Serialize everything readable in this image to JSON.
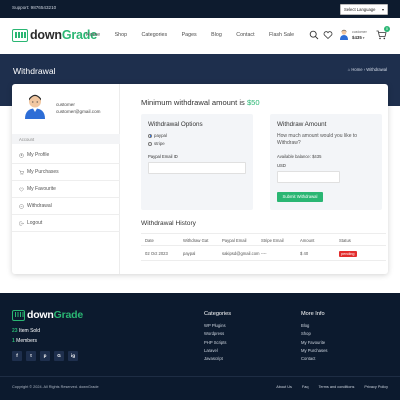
{
  "topbar": {
    "support": "Support: 9876543210",
    "language": "Select Language"
  },
  "header": {
    "logo_main": "down",
    "logo_accent": "Grade",
    "nav": [
      "Home",
      "Shop",
      "Categories",
      "Pages",
      "Blog",
      "Contact",
      "Flash Sale"
    ],
    "customer_label": "customer",
    "customer_balance": "$435",
    "cart_count": "0"
  },
  "banner": {
    "title": "Withdrawal",
    "crumb_home": "Home",
    "crumb_current": "Withdrawal"
  },
  "sidebar": {
    "username": "customer",
    "email": "customer@gmail.com",
    "account_heading": "Account",
    "items": [
      {
        "label": "My Profile",
        "icon": "user-icon"
      },
      {
        "label": "My Purchases",
        "icon": "cart-icon"
      },
      {
        "label": "My Favourite",
        "icon": "heart-icon"
      },
      {
        "label": "Withdrawal",
        "icon": "wallet-icon"
      },
      {
        "label": "Logout",
        "icon": "logout-icon"
      }
    ]
  },
  "main": {
    "min_label": "Minimum withdrawal amount is ",
    "min_amount": "$50",
    "options": {
      "heading": "Withdrawal Options",
      "radio1": "paypal",
      "radio2": "stripe",
      "selected": "paypal",
      "email_label": "Paypal Email ID"
    },
    "amount": {
      "heading": "Withdraw Amount",
      "question": "How much amount would you like to Withdraw?",
      "balance": "Available balance: $435",
      "currency": "USD",
      "button": "Submit Withdrawal"
    },
    "history": {
      "heading": "Withdrawal History",
      "columns": [
        "Date",
        "Withdraw Gat",
        "Paypal Email",
        "Stripe Email",
        "Amount",
        "Status"
      ],
      "rows": [
        {
          "date": "02 Oct 2023",
          "gateway": "paypal",
          "paypal_email": "sakipsd@gmail.com",
          "stripe_email": "----",
          "amount": "$ 40",
          "status": "pending"
        }
      ]
    }
  },
  "footer": {
    "logo_main": "down",
    "logo_accent": "Grade",
    "items_sold_num": "23",
    "items_sold_label": "Item Sold",
    "members_num": "1",
    "members_label": "Members",
    "socials": [
      "f",
      "t",
      "p",
      "G",
      "ig"
    ],
    "categories": {
      "heading": "Categories",
      "links": [
        "WP Plugins",
        "Wordpress",
        "PHP Scripts",
        "Laravel",
        "Javascript"
      ]
    },
    "more_info": {
      "heading": "More Info",
      "links": [
        "Blog",
        "Shop",
        "My Favourite",
        "My Purchases",
        "Contact"
      ]
    },
    "copyright": "Copyright © 2024. All Rights Reserved. downGrade",
    "bottom_links": [
      "About Us",
      "Faq",
      "Terms and conditions",
      "Privacy Policy"
    ]
  },
  "colors": {
    "accent": "#2ab673",
    "dark": "#0d1b2e",
    "banner": "#1e2f4d",
    "badge": "#e22d2d"
  }
}
